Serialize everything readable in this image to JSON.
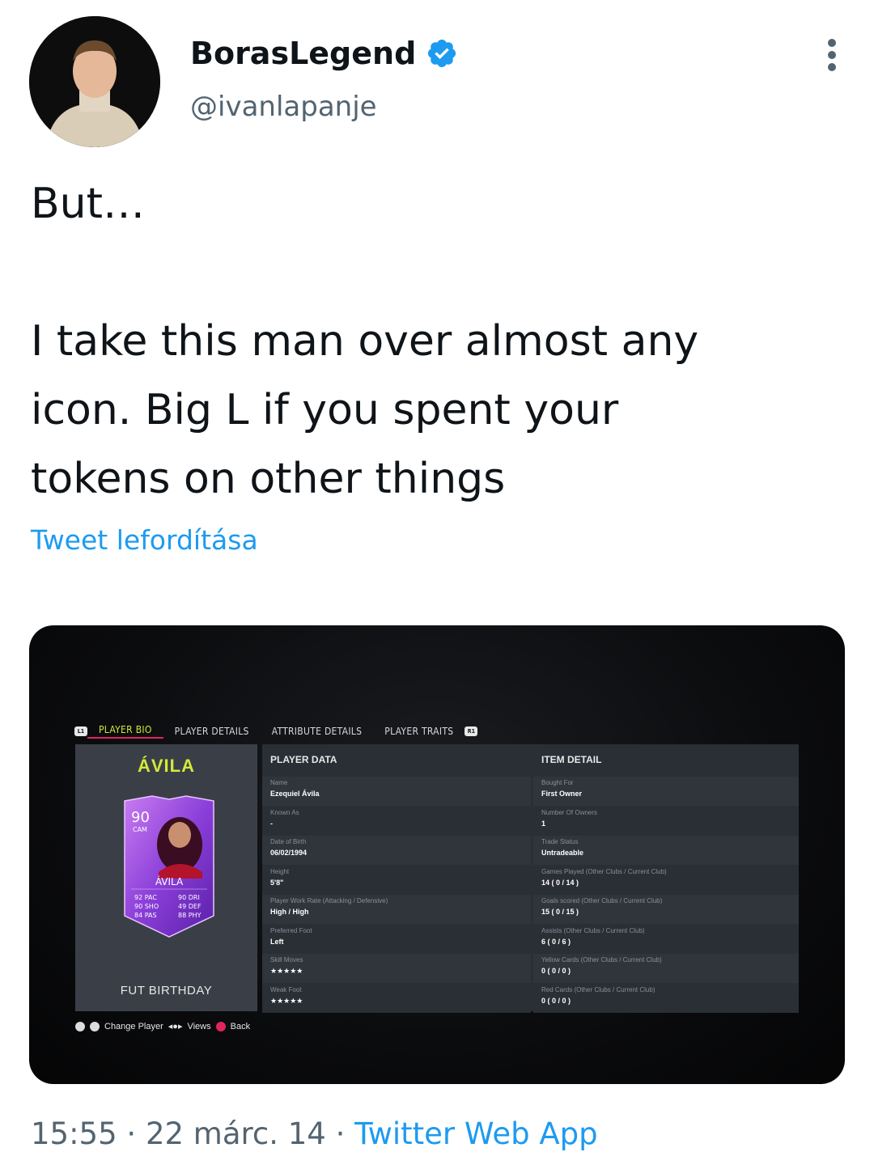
{
  "author": {
    "display_name": "BorasLegend",
    "handle": "@ivanlapanje",
    "verified": true,
    "verified_color": "#1d9bf0"
  },
  "tweet": {
    "lines": [
      "But…",
      "",
      "I take this man over almost any",
      "icon. Big L if you spent your",
      "tokens on other things"
    ],
    "translate_label": "Tweet lefordítása"
  },
  "media": {
    "tabs": [
      "PLAYER BIO",
      "PLAYER DETAILS",
      "ATTRIBUTE DETAILS",
      "PLAYER TRAITS"
    ],
    "bumper_left": "L1",
    "bumper_right": "R1",
    "player_name": "ÁVILA",
    "card": {
      "rating": "90",
      "position": "CAM",
      "name": "ÁVILA",
      "stats_left": [
        "92 PAC",
        "90 SHO",
        "84 PAS"
      ],
      "stats_right": [
        "90 DRI",
        "49 DEF",
        "88 PHY"
      ]
    },
    "card_type": "FUT BIRTHDAY",
    "player_data_header": "PLAYER DATA",
    "item_detail_header": "ITEM DETAIL",
    "player_data": [
      {
        "label": "Name",
        "value": "Ezequiel Ávila"
      },
      {
        "label": "Known As",
        "value": "-"
      },
      {
        "label": "Date of Birth",
        "value": "06/02/1994"
      },
      {
        "label": "Height",
        "value": "5'8\""
      },
      {
        "label": "Player Work Rate (Attacking / Defensive)",
        "value": "High / High"
      },
      {
        "label": "Preferred Foot",
        "value": "Left"
      },
      {
        "label": "Skill Moves",
        "value": "★★★★★"
      },
      {
        "label": "Weak Foot",
        "value": "★★★★★"
      }
    ],
    "item_detail": [
      {
        "label": "Bought For",
        "value": "First Owner"
      },
      {
        "label": "Number Of Owners",
        "value": "1"
      },
      {
        "label": "Trade Status",
        "value": "Untradeable"
      },
      {
        "label": "Games Played (Other Clubs / Current Club)",
        "value": "14 ( 0 / 14 )"
      },
      {
        "label": "Goals scored (Other Clubs / Current Club)",
        "value": "15 ( 0 / 15 )"
      },
      {
        "label": "Assists (Other Clubs / Current Club)",
        "value": "6 ( 0 / 6 )"
      },
      {
        "label": "Yellow Cards (Other Clubs / Current Club)",
        "value": "0 ( 0 / 0 )"
      },
      {
        "label": "Red Cards (Other Clubs / Current Club)",
        "value": "0 ( 0 / 0 )"
      }
    ],
    "footer": {
      "change_player": "Change Player",
      "views": "Views",
      "back": "Back"
    }
  },
  "meta": {
    "time": "15:55",
    "date": "22 márc. 14",
    "separator": "·",
    "app": "Twitter Web App"
  }
}
